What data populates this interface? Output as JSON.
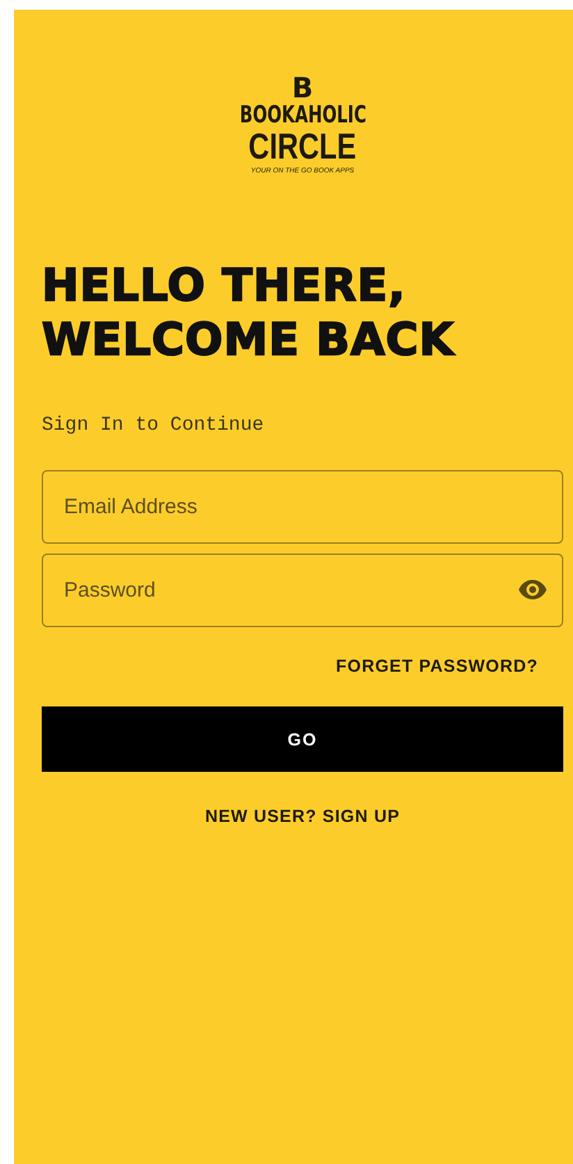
{
  "logo": {
    "mark": "B",
    "line_1": "BOOKAHOLIC",
    "line_2": "CIRCLE",
    "tagline": "YOUR ON THE GO BOOK APPS"
  },
  "heading": [
    "HELLO THERE,",
    "WELCOME BACK"
  ],
  "subtitle": "Sign In to Continue",
  "fields": [
    {
      "kind": "email",
      "placeholder": "Email Address"
    },
    {
      "kind": "password",
      "placeholder": "Password"
    }
  ],
  "forgot_link": "FORGET PASSWORD?",
  "submit_button": "GO",
  "signup_link": "NEW USER? SIGN UP"
}
